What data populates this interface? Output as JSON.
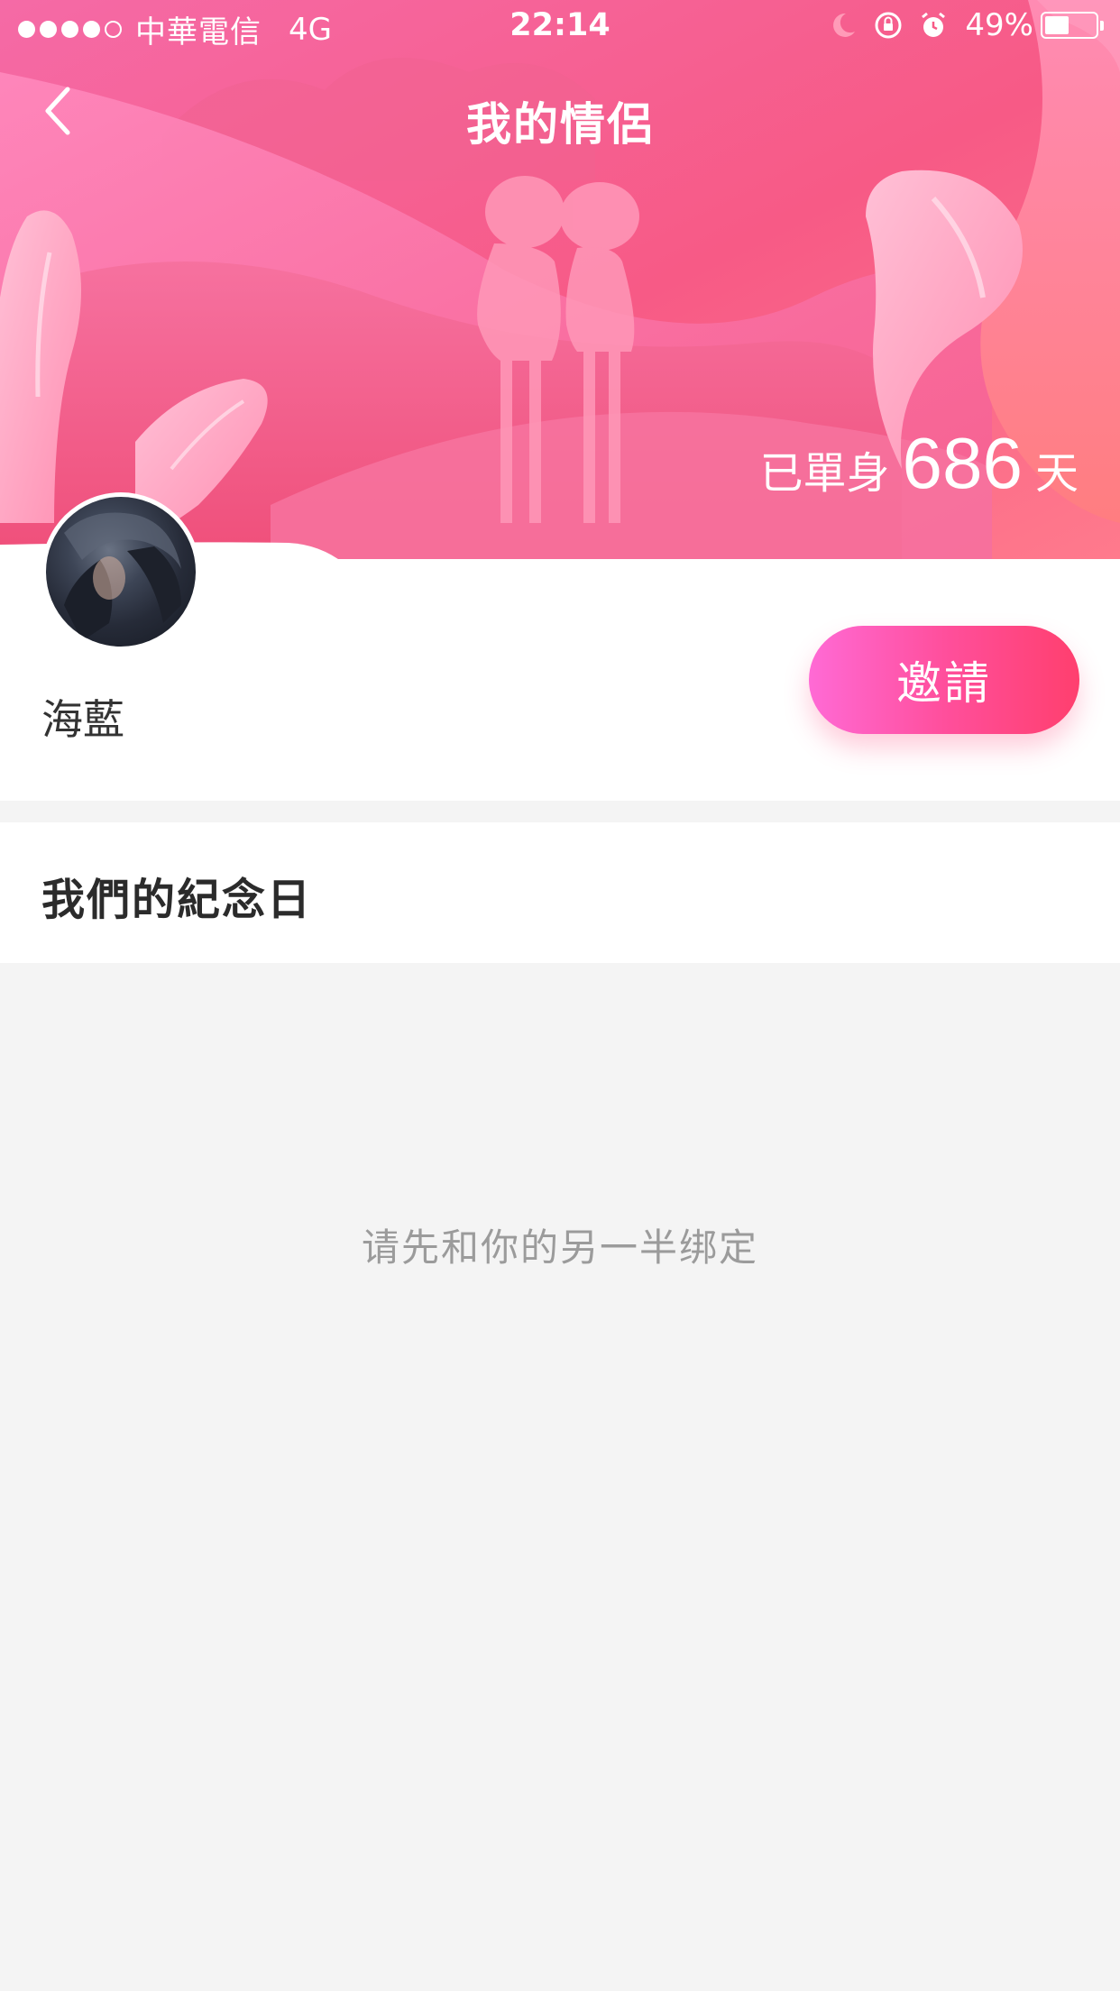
{
  "status_bar": {
    "signal_bars_filled": 4,
    "signal_bars_total": 5,
    "carrier": "中華電信",
    "network": "4G",
    "time": "22:14",
    "icons": [
      "moon-icon",
      "rotation-lock-icon",
      "alarm-icon"
    ],
    "battery_text": "49%",
    "battery_level": 0.49
  },
  "nav": {
    "back_icon": "chevron-left-icon",
    "title": "我的情侶"
  },
  "hero": {
    "single_prefix": "已單身",
    "single_days": "686",
    "single_suffix": "天"
  },
  "profile": {
    "name": "海藍",
    "invite_label": "邀請"
  },
  "anniversary": {
    "title": "我們的紀念日",
    "empty_hint": "请先和你的另一半绑定"
  },
  "colors": {
    "hero_primary": "#f9527f",
    "hero_light": "#ff8fb0",
    "invite_gradient_start": "#ff6ad5",
    "invite_gradient_end": "#ff3f6e",
    "background": "#f4f4f4"
  }
}
